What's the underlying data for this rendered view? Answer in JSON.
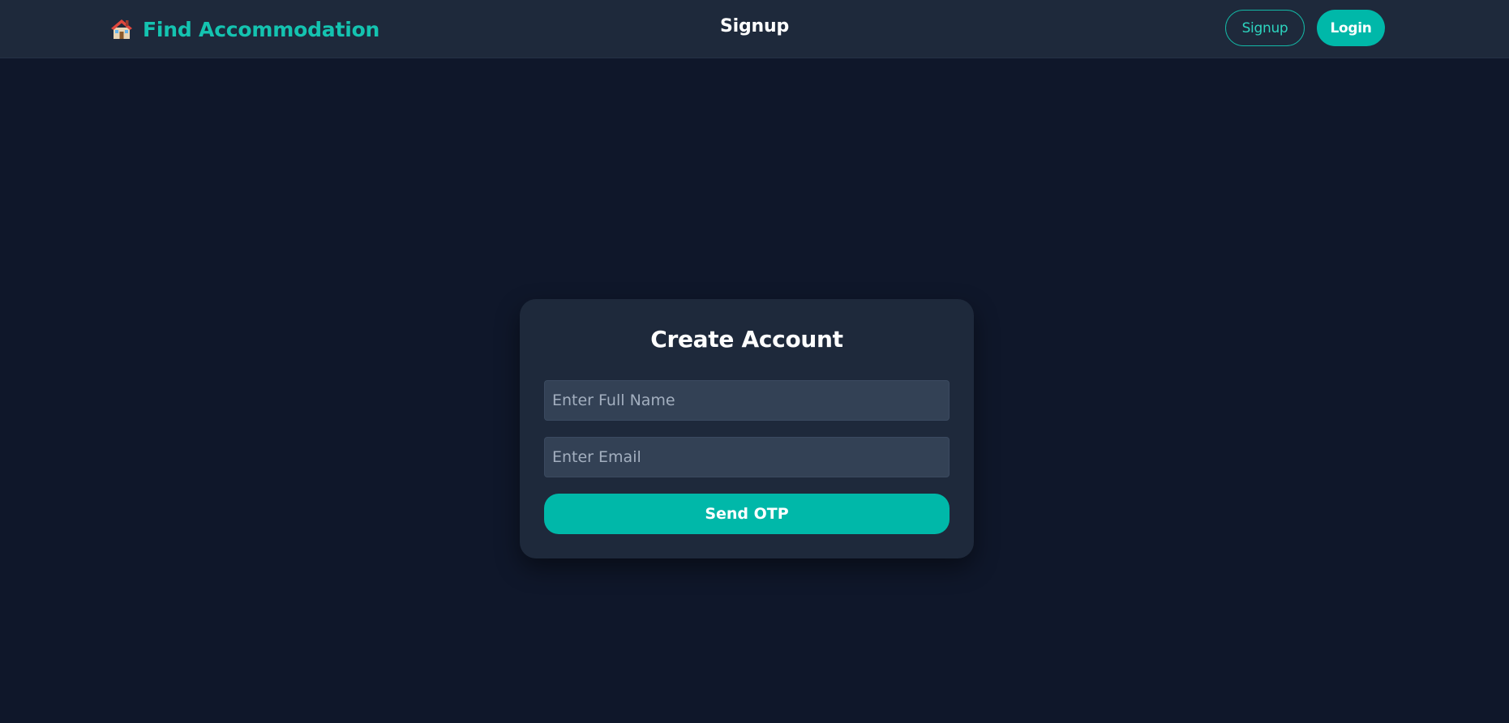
{
  "header": {
    "brand_icon": "house-icon",
    "brand_title": "Find Accommodation",
    "page_heading": "Signup",
    "signup_label": "Signup",
    "login_label": "Login"
  },
  "form": {
    "title": "Create Account",
    "name_placeholder": "Enter Full Name",
    "name_value": "",
    "email_placeholder": "Enter Email",
    "email_value": "",
    "submit_label": "Send OTP"
  },
  "colors": {
    "background": "#0f172a",
    "surface": "#1e293b",
    "input": "#334155",
    "accent": "#00b8a9",
    "accent_text": "#14c3b0"
  }
}
